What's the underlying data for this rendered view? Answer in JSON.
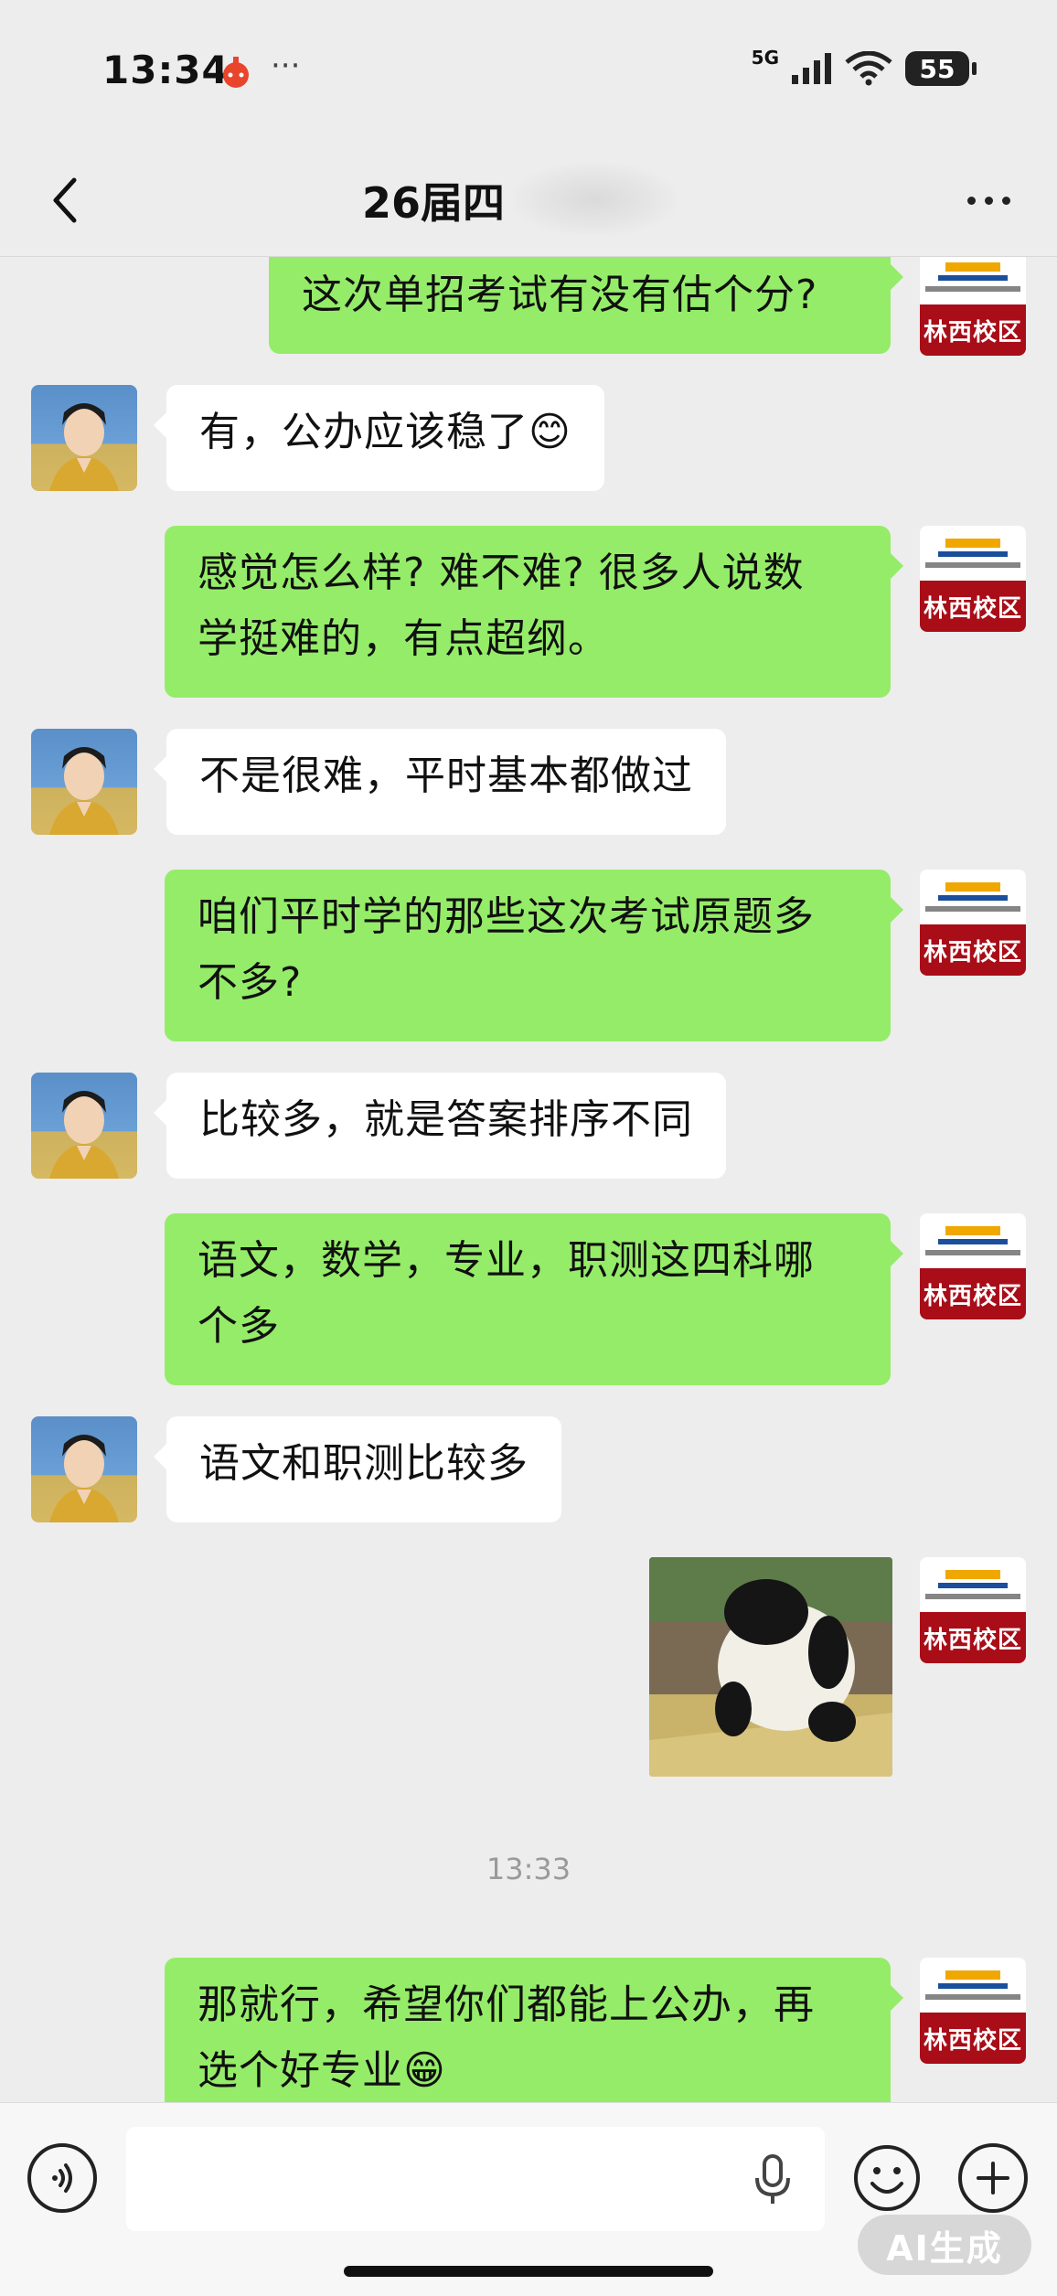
{
  "status_bar": {
    "time": "13:34",
    "dots": "···",
    "network": "5G",
    "battery": "55"
  },
  "header": {
    "title": "26届四"
  },
  "avatar_me_label": "林西校区",
  "messages": [
    {
      "from": "me",
      "lines": [
        "这次单招考试有没有估个分?"
      ]
    },
    {
      "from": "other",
      "lines": [
        "有，公办应该稳了"
      ],
      "emoji": "😊"
    },
    {
      "from": "me",
      "lines": [
        "感觉怎么样? 难不难? 很多人说数",
        "学挺难的，有点超纲。"
      ]
    },
    {
      "from": "other",
      "lines": [
        "不是很难，平时基本都做过"
      ]
    },
    {
      "from": "me",
      "lines": [
        "咱们平时学的那些这次考试原题多",
        "不多?"
      ]
    },
    {
      "from": "other",
      "lines": [
        "比较多，就是答案排序不同"
      ]
    },
    {
      "from": "me",
      "lines": [
        "语文，数学，专业，职测这四科哪",
        "个多"
      ]
    },
    {
      "from": "other",
      "lines": [
        "语文和职测比较多"
      ]
    },
    {
      "from": "me",
      "type": "image",
      "alt": "panda-sticker"
    },
    {
      "from": "me",
      "lines": [
        "那就行，希望你们都能上公办，再",
        "选个好专业"
      ],
      "emoji": "😁"
    }
  ],
  "timestamp": "13:33",
  "input_bar": {
    "placeholder": "",
    "ai_badge": "AI生成"
  }
}
